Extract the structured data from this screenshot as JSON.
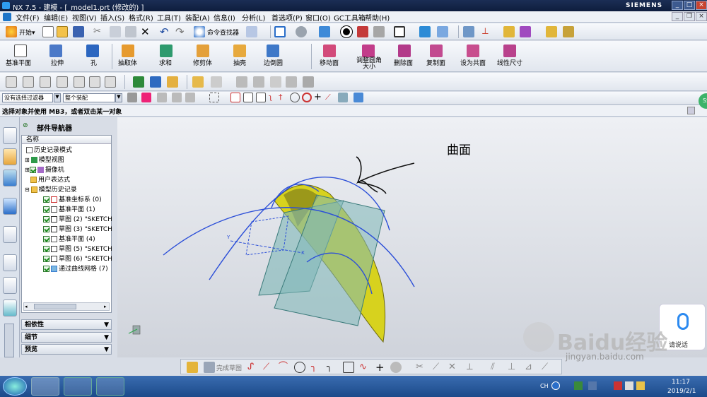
{
  "window": {
    "title": "NX 7.5 - 建模 - [_model1.prt (修改的) ]",
    "brand": "SIEMENS",
    "controls": [
      "_",
      "□",
      "×"
    ]
  },
  "menu": [
    "文件(F)",
    "编辑(E)",
    "视图(V)",
    "插入(S)",
    "格式(R)",
    "工具(T)",
    "装配(A)",
    "信息(I)",
    "分析(L)",
    "首选项(P)",
    "窗口(O)",
    "GC工具箱",
    "帮助(H)"
  ],
  "toolbar1": {
    "start_label": "开始▾",
    "command_finder": "命令查找器"
  },
  "toolbar2": {
    "items": [
      "基准平面",
      "拉伸",
      "孔",
      "抽取体",
      "求和",
      "修剪体",
      "抽壳",
      "边倒圆",
      "移动面",
      "调整圆角大小",
      "删除面",
      "复制面",
      "设为共面",
      "线性尺寸"
    ]
  },
  "selection": {
    "filter": "没有选择过滤器",
    "scope": "整个装配"
  },
  "status": {
    "cue": "选择对象并使用 MB3，或者双击某一对象"
  },
  "navigator": {
    "title": "部件导航器",
    "column": "名称",
    "nodes": [
      {
        "label": "历史记录模式",
        "indent": 0
      },
      {
        "label": "模型视图",
        "indent": 0
      },
      {
        "label": "摄像机",
        "indent": 0
      },
      {
        "label": "用户表达式",
        "indent": 0
      },
      {
        "label": "模型历史记录",
        "indent": 0
      },
      {
        "label": "基准坐标系 (0)",
        "indent": 1
      },
      {
        "label": "基准平面 (1)",
        "indent": 1
      },
      {
        "label": "草图 (2) \"SKETCH",
        "indent": 1
      },
      {
        "label": "草图 (3) \"SKETCH",
        "indent": 1
      },
      {
        "label": "基准平面 (4)",
        "indent": 1
      },
      {
        "label": "草图 (5) \"SKETCH",
        "indent": 1
      },
      {
        "label": "草图 (6) \"SKETCH",
        "indent": 1
      },
      {
        "label": "通过曲线网格 (7)",
        "indent": 1
      }
    ],
    "panels": [
      "相依性",
      "细节",
      "预览"
    ]
  },
  "viewport": {
    "annotation": "曲面"
  },
  "bottom": {
    "finish_sketch": "完成草图"
  },
  "voice": {
    "label": "请说话"
  },
  "watermark": {
    "brand": "Baidu经验",
    "url": "jingyan.baidu.com"
  },
  "taskbar": {
    "time": "11:17",
    "date": "2019/2/1",
    "lang": "CH"
  }
}
